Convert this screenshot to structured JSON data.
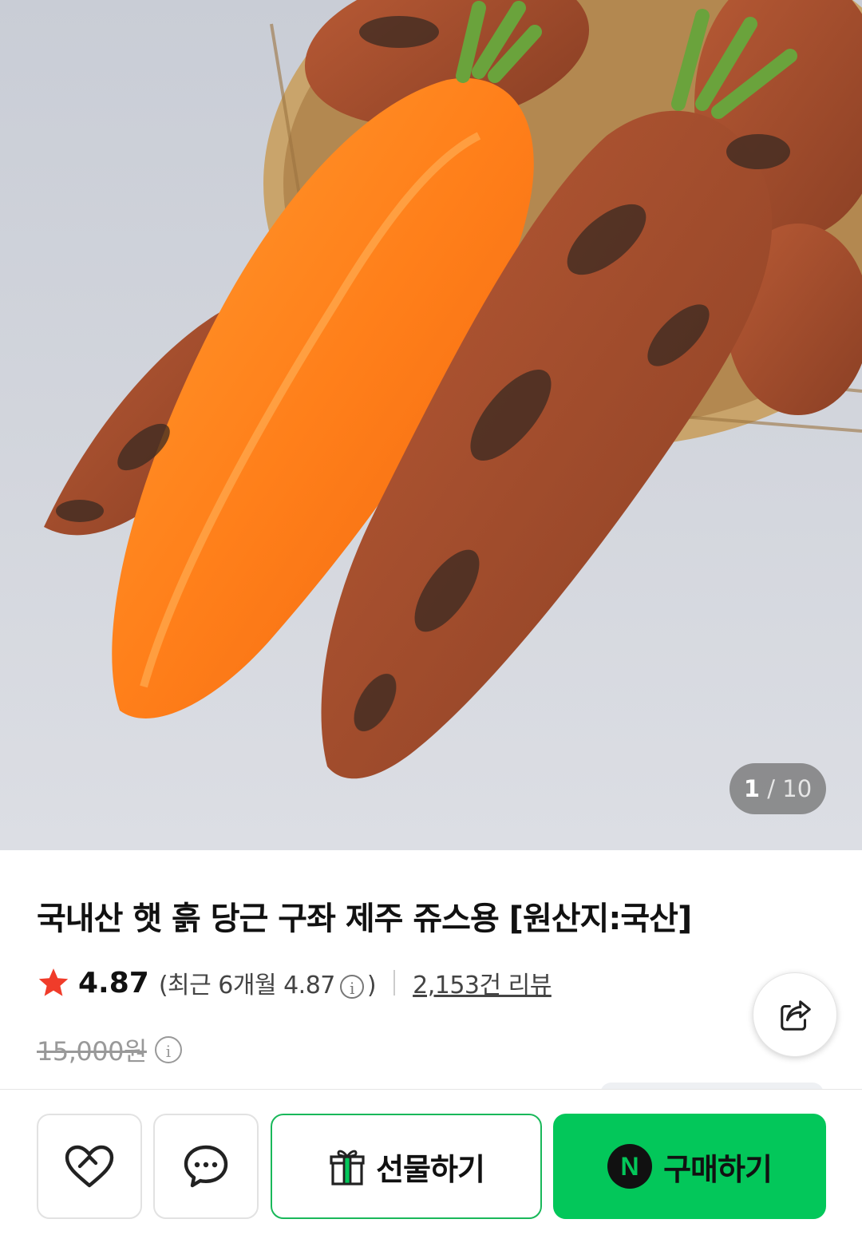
{
  "gallery": {
    "current": "1",
    "separator": "/",
    "total": "10",
    "image_subject": "carrots"
  },
  "product": {
    "title": "국내산 햇 흙 당근 구좌 제주 쥬스용 [원산지:국산]",
    "rating": "4.87",
    "recent_rating_text": "(최근 6개월 4.87",
    "recent_rating_close": ")",
    "review_count_text": "2,153건 리뷰",
    "original_price": "15,000원"
  },
  "icons": {
    "star": "star-icon",
    "info": "info-icon",
    "share": "share-icon",
    "like": "heart-icon",
    "talk": "chat-bubble-icon",
    "gift": "gift-icon",
    "naver": "naver-n-icon"
  },
  "info_glyph": "i",
  "actions": {
    "gift_label": "선물하기",
    "buy_label": "구매하기",
    "naver_mark": "N"
  },
  "colors": {
    "accent_green": "#03c75a",
    "star_red": "#f03c2a"
  }
}
